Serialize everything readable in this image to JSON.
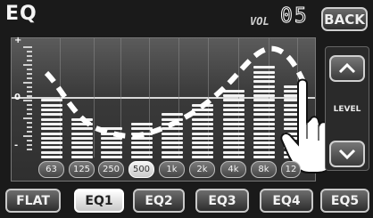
{
  "header": {
    "title": "EQ",
    "vol_label": "VOL",
    "vol_value": "05",
    "back_label": "BACK"
  },
  "scale": {
    "plus": "+",
    "zero": "0",
    "minus": "-"
  },
  "bands": [
    {
      "freq": "63",
      "level": 0.6
    },
    {
      "freq": "125",
      "level": 0.42
    },
    {
      "freq": "250",
      "level": 0.32
    },
    {
      "freq": "500",
      "level": 0.38,
      "active": true
    },
    {
      "freq": "1k",
      "level": 0.47
    },
    {
      "freq": "2k",
      "level": 0.55
    },
    {
      "freq": "4k",
      "level": 0.7
    },
    {
      "freq": "8k",
      "level": 0.9
    },
    {
      "freq": "12",
      "level": 0.72
    }
  ],
  "side": {
    "level_label": "LEVEL",
    "up_icon": "chevron-up-icon",
    "down_icon": "chevron-down-icon"
  },
  "presets": [
    "FLAT",
    "EQ1",
    "EQ2",
    "EQ3",
    "EQ4",
    "EQ5"
  ],
  "selected_preset": "EQ1",
  "colors": {
    "accent": "#ffffff",
    "background": "#1a1a1a"
  }
}
